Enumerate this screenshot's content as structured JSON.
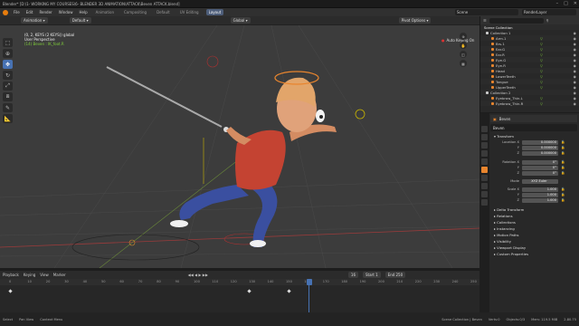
{
  "window": {
    "title": "Blender* [D:\\1- WORKING MY COURSES\\6- BLENDER 3D ANIMATION\\ATTACK\\Beven ATTACK.blend]"
  },
  "menu": {
    "items": [
      "File",
      "Edit",
      "Render",
      "Window",
      "Help"
    ],
    "tabs": [
      "Animation",
      "Compositing",
      "Default",
      "UV Editing",
      "Layout"
    ],
    "active_tab": "Layout"
  },
  "scene": {
    "scene_label": "Scene",
    "view_layer_label": "RenderLayer"
  },
  "viewport_header": {
    "mode": "Animation",
    "pose": "Default",
    "orientation": "Global",
    "snap": "Pivot Options"
  },
  "viewport": {
    "info_line1": "(0, 2, KEYS (2 KEYS)) global",
    "info_line2": "User Perspective",
    "info_line3": "(14) Beven : IK_foot.R",
    "auto_keying": "Auto Keying On"
  },
  "timeline_header": {
    "items": [
      "Playback",
      "Keying",
      "View",
      "Marker"
    ],
    "current_frame": "16",
    "start_label": "Start",
    "start": "1",
    "end_label": "End",
    "end": "250"
  },
  "timeline": {
    "ticks": [
      "0",
      "10",
      "20",
      "30",
      "40",
      "50",
      "60",
      "70",
      "80",
      "90",
      "100",
      "110",
      "120",
      "130",
      "140",
      "150",
      "160",
      "170",
      "180",
      "190",
      "200",
      "210",
      "220",
      "230",
      "240",
      "250"
    ]
  },
  "statusbar": {
    "items": [
      "Select",
      "Pan View",
      "Context Menu",
      "Scene Collection | Beven",
      "Verts:0",
      "Objects:0/3",
      "Mem: 119.5 MiB",
      "2.80.75"
    ]
  },
  "outliner": {
    "title": "Scene Collection",
    "rows": [
      {
        "name": "Collection 1"
      },
      {
        "name": "Arm.1"
      },
      {
        "name": "Brs.1"
      },
      {
        "name": "Ear.G"
      },
      {
        "name": "Ear.R"
      },
      {
        "name": "Eye.G"
      },
      {
        "name": "Eye.R"
      },
      {
        "name": "Head"
      },
      {
        "name": "LowerTeeth"
      },
      {
        "name": "Tongue"
      },
      {
        "name": "UpperTeeth"
      },
      {
        "name": "Collection 2"
      },
      {
        "name": "Eyebrow_Thin.L"
      },
      {
        "name": "Eyebrow_Thin.R"
      }
    ]
  },
  "properties": {
    "header": "Beven",
    "object_name": "Beven",
    "transform_label": "Transform",
    "location": {
      "label": "Location X",
      "x": "0.000000",
      "y": "0.000000",
      "z": "0.000000"
    },
    "rotation": {
      "label": "Rotation X",
      "x": "0°",
      "y": "0°",
      "z": "0°"
    },
    "mode": {
      "label": "Mode",
      "value": "XYZ Euler"
    },
    "scale": {
      "label": "Scale X",
      "x": "1.000",
      "y": "1.000",
      "z": "1.000"
    },
    "sections": [
      "Delta Transform",
      "Relations",
      "Collections",
      "Instancing",
      "Motion Paths",
      "Visibility",
      "Viewport Display",
      "Custom Properties"
    ]
  },
  "colors": {
    "accent": "#4772b3",
    "active_tab": "#4d5d79",
    "orange": "#e87d0d",
    "viewport_bg": "#3c3c3c"
  }
}
